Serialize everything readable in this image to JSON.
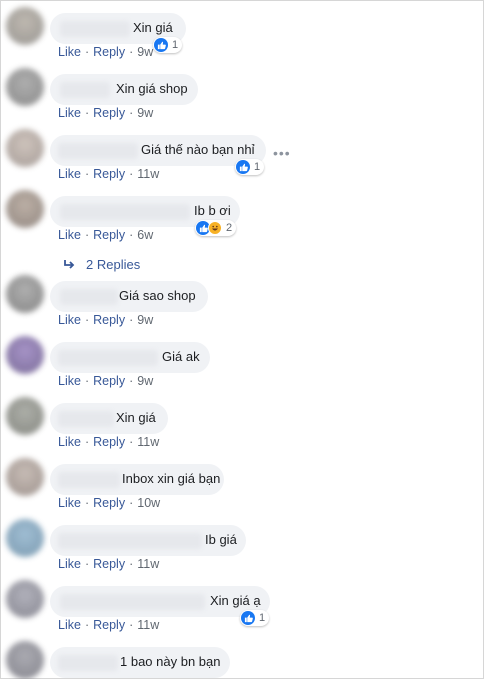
{
  "actions": {
    "like": "Like",
    "reply": "Reply",
    "separator": "·"
  },
  "comments": [
    {
      "text": "Xin giá",
      "time": "9w",
      "reactions": {
        "types": [
          "like"
        ],
        "count": "1"
      }
    },
    {
      "text": "Xin giá shop",
      "time": "9w"
    },
    {
      "text": "Giá thế nào bạn nhỉ",
      "time": "11w",
      "reactions": {
        "types": [
          "like"
        ],
        "count": "1"
      },
      "more_icon": "more-horizontal-icon"
    },
    {
      "text": "Ib b ơi",
      "time": "6w",
      "reactions": {
        "types": [
          "like",
          "haha"
        ],
        "count": "2"
      }
    },
    {
      "text": "Giá sao shop",
      "time": "9w"
    },
    {
      "text": "Giá ak",
      "time": "9w"
    },
    {
      "text": "Xin giá",
      "time": "11w"
    },
    {
      "text": "Inbox xin giá bạn",
      "time": "10w"
    },
    {
      "text": "Ib giá",
      "time": "11w"
    },
    {
      "text": "Xin giá ạ",
      "time": "11w",
      "reactions": {
        "types": [
          "like"
        ],
        "count": "1"
      }
    },
    {
      "text": "1 bao này bn bạn"
    }
  ],
  "replies_link": {
    "label": "2 Replies",
    "icon": "reply-arrow-icon"
  },
  "colors": {
    "link": "#385898",
    "bubble": "#f0f2f5",
    "like": "#1877f2",
    "muted": "#606770"
  }
}
